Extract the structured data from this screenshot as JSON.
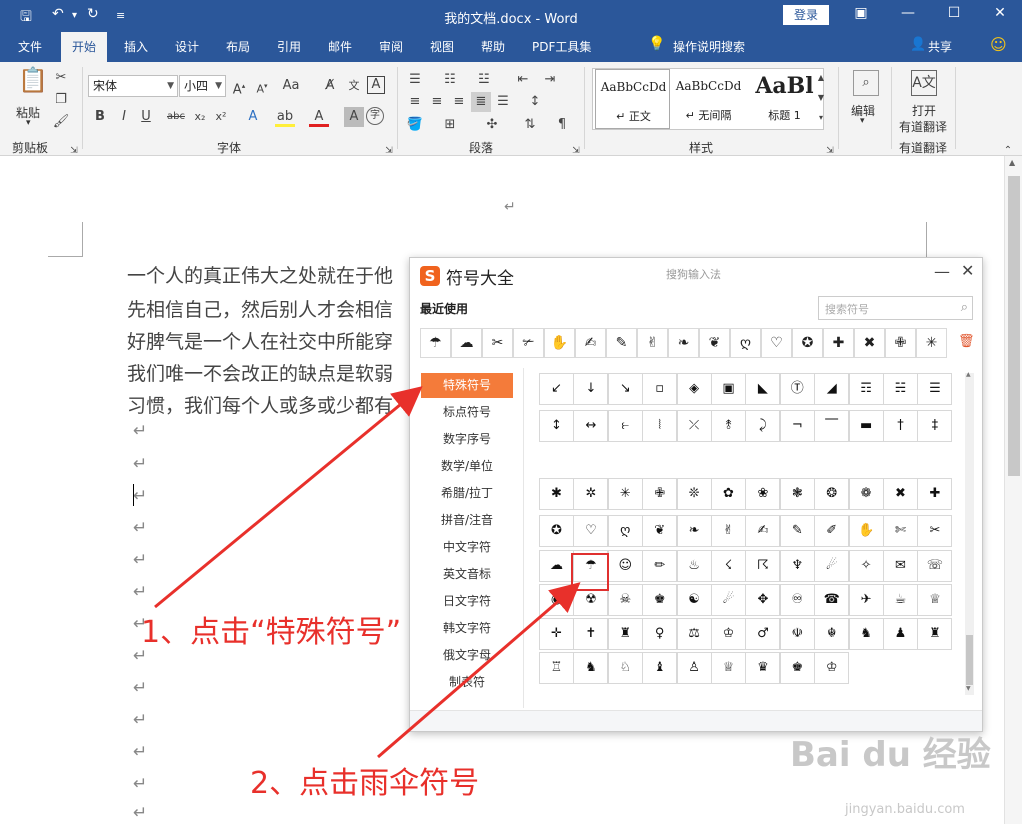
{
  "window": {
    "title": "我的文档.docx  -  Word",
    "login_label": "登录",
    "controls": [
      "▣",
      "—",
      "☐",
      "✕"
    ]
  },
  "quick_access": {
    "save_icon": "save-icon",
    "undo_icon": "undo-icon",
    "redo_icon": "redo-icon"
  },
  "tabs": [
    "文件",
    "开始",
    "插入",
    "设计",
    "布局",
    "引用",
    "邮件",
    "审阅",
    "视图",
    "帮助",
    "PDF工具集"
  ],
  "active_tab": "开始",
  "tell_me": "操作说明搜索",
  "share_label": "共享",
  "ribbon": {
    "clipboard": {
      "paste_label": "粘贴",
      "group_label": "剪贴板"
    },
    "font": {
      "font_name": "宋体",
      "font_size": "小四",
      "group_label": "字体"
    },
    "paragraph": {
      "group_label": "段落"
    },
    "styles": {
      "items": [
        {
          "sample": "AaBbCcDd",
          "name": "↵ 正文"
        },
        {
          "sample": "AaBbCcDd",
          "name": "↵ 无间隔"
        },
        {
          "sample": "AaBl",
          "name": "标题 1"
        }
      ],
      "group_label": "样式"
    },
    "editing": {
      "label": "编辑"
    },
    "translate": {
      "line1": "打开",
      "line2": "有道翻译",
      "group_label": "有道翻译"
    }
  },
  "document": {
    "paragraphs": [
      "一个人的真正伟大之处就在于他",
      "先相信自己，然后别人才会相信",
      "好脾气是一个人在社交中所能穿",
      "我们唯一不会改正的缺点是软弱",
      "习惯，我们每个人或多或少都有"
    ],
    "para_mark": "↵"
  },
  "dialog": {
    "logo": "S",
    "title": "符号大全",
    "ime_name": "搜狗输入法",
    "recent_title": "最近使用",
    "search_placeholder": "搜索符号",
    "recent_symbols": [
      "☂",
      "☁",
      "✂",
      "✃",
      "✋",
      "✍",
      "✎",
      "✌",
      "❧",
      "❦",
      "ღ",
      "♡",
      "✪",
      "✚",
      "✖",
      "✙",
      "✳"
    ],
    "categories": [
      "特殊符号",
      "标点符号",
      "数字序号",
      "数学/单位",
      "希腊/拉丁",
      "拼音/注音",
      "中文字符",
      "英文音标",
      "日文字符",
      "韩文字符",
      "俄文字母",
      "制表符"
    ],
    "active_category": "特殊符号",
    "grid_rows": [
      [
        "↙",
        "↓",
        "↘",
        "▫",
        "◈",
        "▣",
        "◣",
        "Ⓣ",
        "◢",
        "☶",
        "☵",
        "☰"
      ],
      [
        "↕",
        "↔",
        "⥼",
        "⦚",
        "⤫",
        "⥉",
        "⤸",
        "¬",
        "⎺",
        "▬",
        "†",
        "‡"
      ],
      [
        "✱",
        "✲",
        "✳",
        "✙",
        "❊",
        "✿",
        "❀",
        "❃",
        "❂",
        "❁",
        "✖",
        "✚"
      ],
      [
        "✪",
        "♡",
        "ღ",
        "❦",
        "❧",
        "✌",
        "✍",
        "✎",
        "✐",
        "✋",
        "✄",
        "✂"
      ],
      [
        "☁",
        "☂",
        "☺",
        "✏",
        "♨",
        "☇",
        "☈",
        "♆",
        "☄",
        "✧",
        "✉",
        "☏"
      ],
      [
        "◉",
        "☢",
        "☠",
        "♚",
        "☯",
        "☄",
        "✥",
        "♾",
        "☎",
        "✈",
        "☕",
        "♕"
      ],
      [
        "✛",
        "✝",
        "♜",
        "♀",
        "⚖",
        "♔",
        "♂",
        "☫",
        "☬",
        "♞",
        "♟",
        "♜"
      ],
      [
        "♖",
        "♞",
        "♘",
        "♝",
        "♙",
        "♕",
        "♛",
        "♚",
        "♔"
      ]
    ]
  },
  "annotations": {
    "step1": "1、点击“特殊符号”",
    "step2": "2、点击雨伞符号",
    "color": "#e8302b"
  },
  "watermark": {
    "brand": "Bai du 经验",
    "url": "jingyan.baidu.com"
  }
}
